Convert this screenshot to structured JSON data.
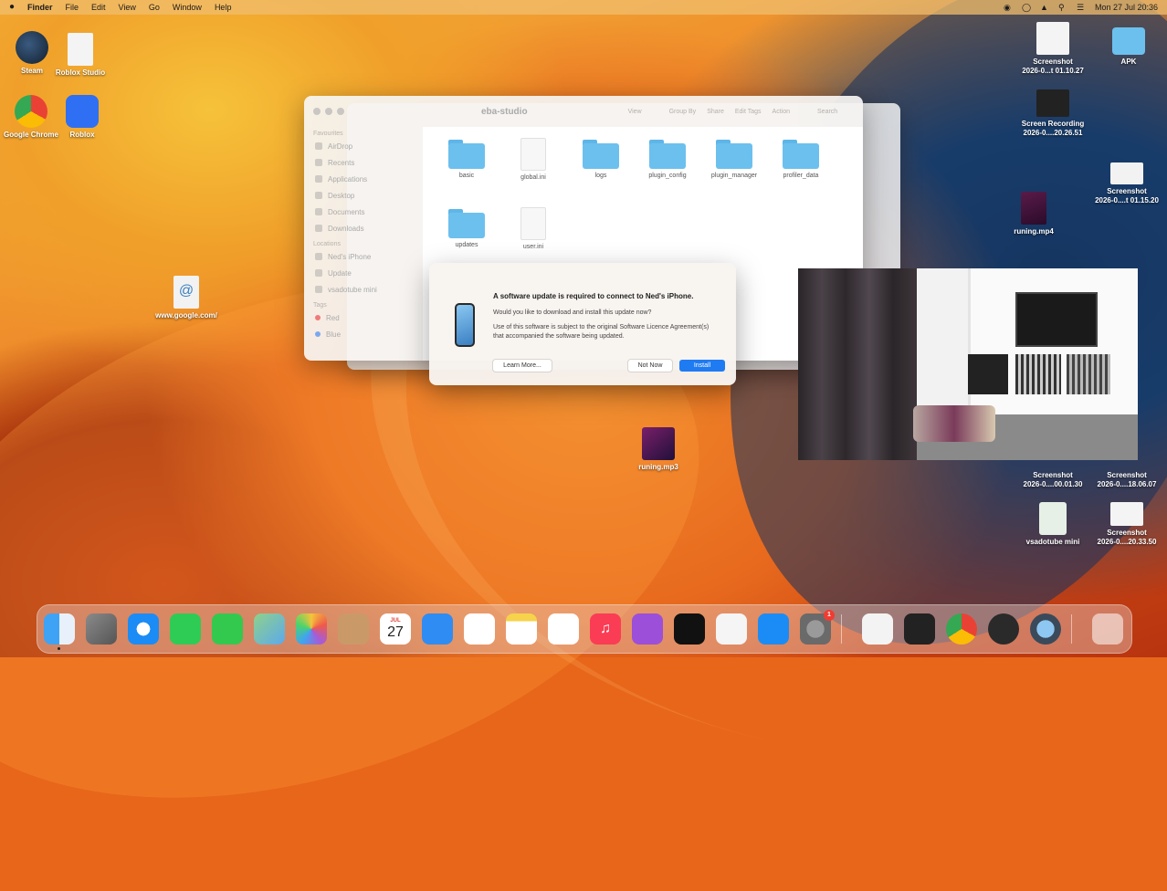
{
  "menubar": {
    "app_name": "Finder",
    "menus": [
      "File",
      "Edit",
      "View",
      "Go",
      "Window",
      "Help"
    ],
    "clock": "Mon 27 Jul  20:36"
  },
  "desktop_icons": {
    "steam": "Steam",
    "roblox_studio": "Roblox Studio",
    "google_chrome": "Google Chrome",
    "roblox": "Roblox",
    "google_link": "www.google.com/",
    "google_link_badge": "@",
    "screenshot_1_line1": "Screenshot",
    "screenshot_1_line2": "2026-0...t 01.10.27",
    "apk": "APK",
    "screen_recording_line1": "Screen Recording",
    "screen_recording_line2": "2026-0....20.26.51",
    "running_mp4": "runing.mp4",
    "screenshot_2_line1": "Screenshot",
    "screenshot_2_line2": "2026-0....t 01.15.20",
    "running_mp3": "runing.mp3",
    "screenshot_3_line1": "Screenshot",
    "screenshot_3_line2": "2026-0....00.01.30",
    "screenshot_4_line1": "Screenshot",
    "screenshot_4_line2": "2026-0....18.06.07",
    "vsadotube_mini": "vsadotube mini",
    "screenshot_5_line1": "Screenshot",
    "screenshot_5_line2": "2026-0....20.33.50"
  },
  "finder": {
    "title": "eba-studio",
    "toolbar": [
      "View",
      "Group By",
      "Share",
      "Edit Tags",
      "Action",
      "Search"
    ],
    "sidebar": {
      "favourites_header": "Favourites",
      "favourites": [
        "AirDrop",
        "Recents",
        "Applications",
        "Desktop",
        "Documents",
        "Downloads"
      ],
      "locations_header": "Locations",
      "locations": [
        "Ned's iPhone",
        "Update",
        "vsadotube mini"
      ],
      "tags_header": "Tags",
      "tags": [
        "Red",
        "Blue"
      ]
    },
    "items": [
      {
        "name": "basic",
        "kind": "folder"
      },
      {
        "name": "global.ini",
        "kind": "doc"
      },
      {
        "name": "logs",
        "kind": "folder"
      },
      {
        "name": "plugin_config",
        "kind": "folder"
      },
      {
        "name": "plugin_manager",
        "kind": "folder"
      },
      {
        "name": "profiler_data",
        "kind": "folder"
      },
      {
        "name": "updates",
        "kind": "folder"
      },
      {
        "name": "user.ini",
        "kind": "doc"
      }
    ]
  },
  "dialog": {
    "heading": "A software update is required to connect to Ned's iPhone.",
    "question": "Would you like to download and install this update now?",
    "terms": "Use of this software is subject to the original Software Licence Agreement(s) that accompanied the software being updated.",
    "learn_more": "Learn More...",
    "not_now": "Not Now",
    "install": "Install"
  },
  "dock": {
    "apps": [
      "finder-icon",
      "launchpad-icon",
      "safari-icon",
      "facetime-icon",
      "messages-icon",
      "maps-icon",
      "photos-icon",
      "contacts-icon",
      "calendar-icon",
      "mail-icon",
      "reminders-icon",
      "notes-icon",
      "freeform-icon",
      "music-icon",
      "podcasts-icon",
      "tv-icon",
      "news-icon",
      "app-store-icon",
      "system-settings-icon",
      "textedit-icon",
      "terminal-icon",
      "chrome-icon",
      "obs-icon",
      "quicktime-icon",
      "trash-icon"
    ],
    "calendar_month": "JUL",
    "calendar_day": "27",
    "settings_badge": "1"
  }
}
